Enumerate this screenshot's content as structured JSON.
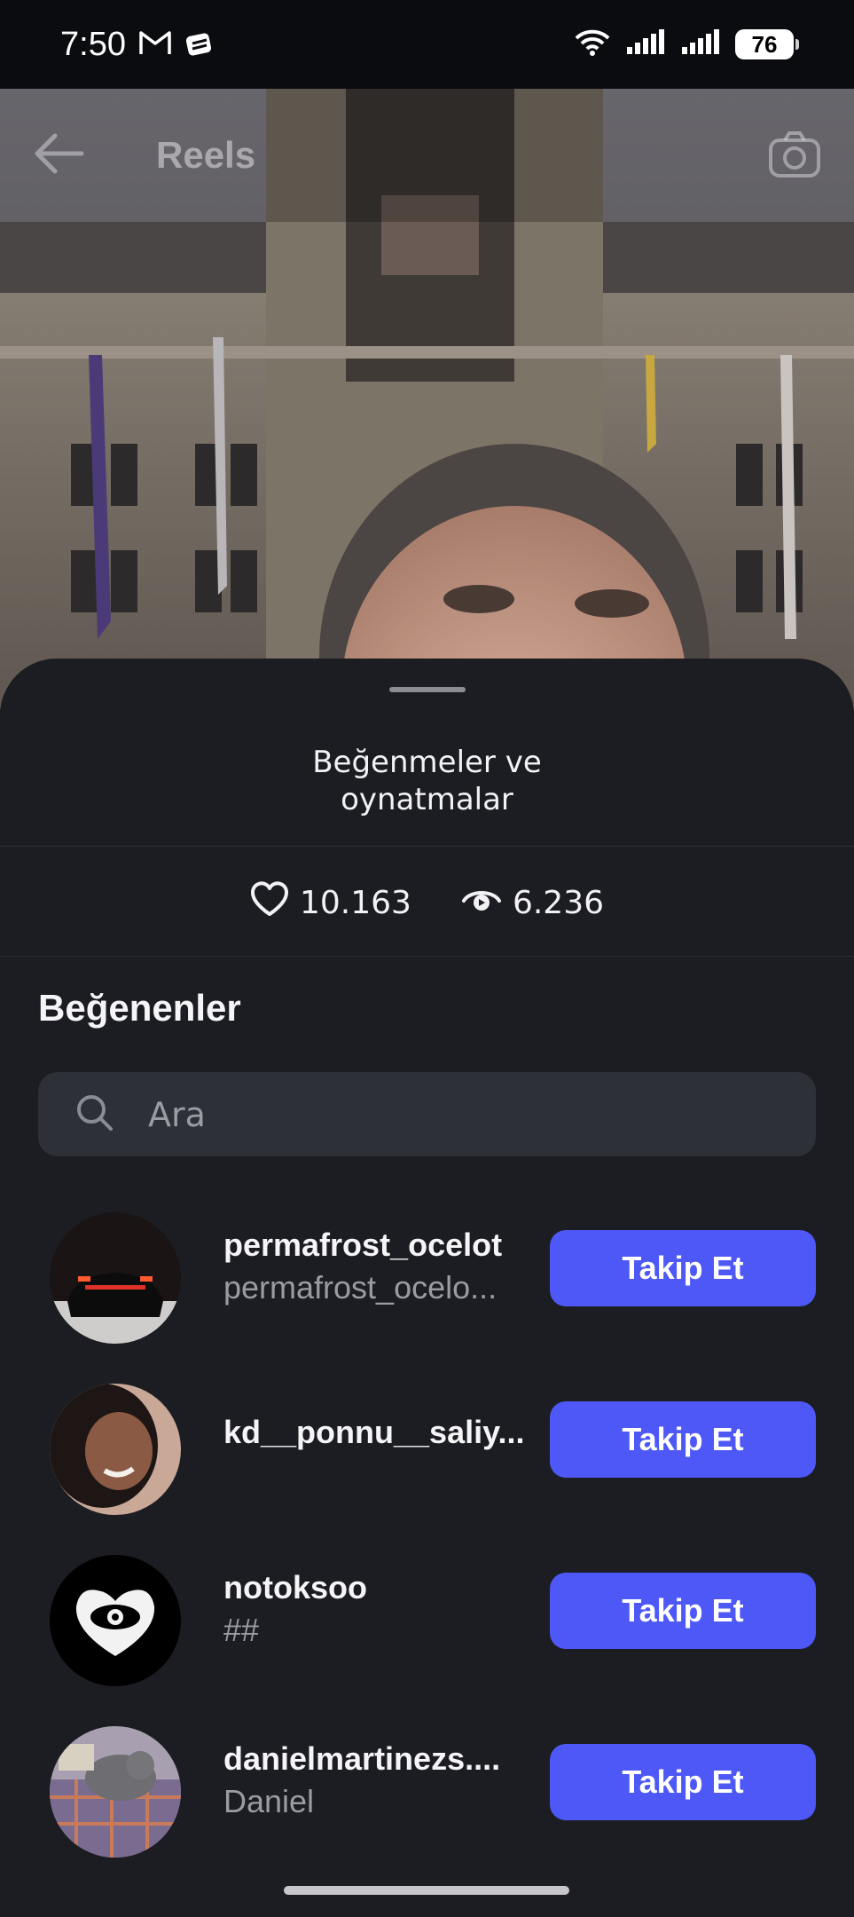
{
  "status_bar": {
    "time": "7:50",
    "battery": "76",
    "icons": [
      "gmail-icon",
      "app-notification-icon",
      "wifi-icon",
      "signal-icon",
      "signal-icon",
      "battery-icon"
    ]
  },
  "reel": {
    "title": "Reels",
    "back_icon": "back-arrow-icon",
    "camera_icon": "camera-icon"
  },
  "sheet": {
    "title_line1": "Beğenmeler ve",
    "title_line2": "oynatmalar",
    "likes_count": "10.163",
    "plays_count": "6.236",
    "likers_heading": "Beğenenler",
    "search_placeholder": "Ara"
  },
  "likers": [
    {
      "username": "permafrost_ocelot",
      "subname": "permafrost_ocelo...",
      "button": "Takip Et"
    },
    {
      "username": "kd__ponnu__saliy...",
      "subname": "",
      "button": "Takip Et"
    },
    {
      "username": "notoksoo",
      "subname": "##",
      "button": "Takip Et"
    },
    {
      "username": "danielmartinezs....",
      "subname": "Daniel",
      "button": "Takip Et"
    }
  ],
  "colors": {
    "sheet_bg": "#1c1d22",
    "button_accent": "#4e58f7",
    "secondary_text": "#9a9ca3"
  }
}
